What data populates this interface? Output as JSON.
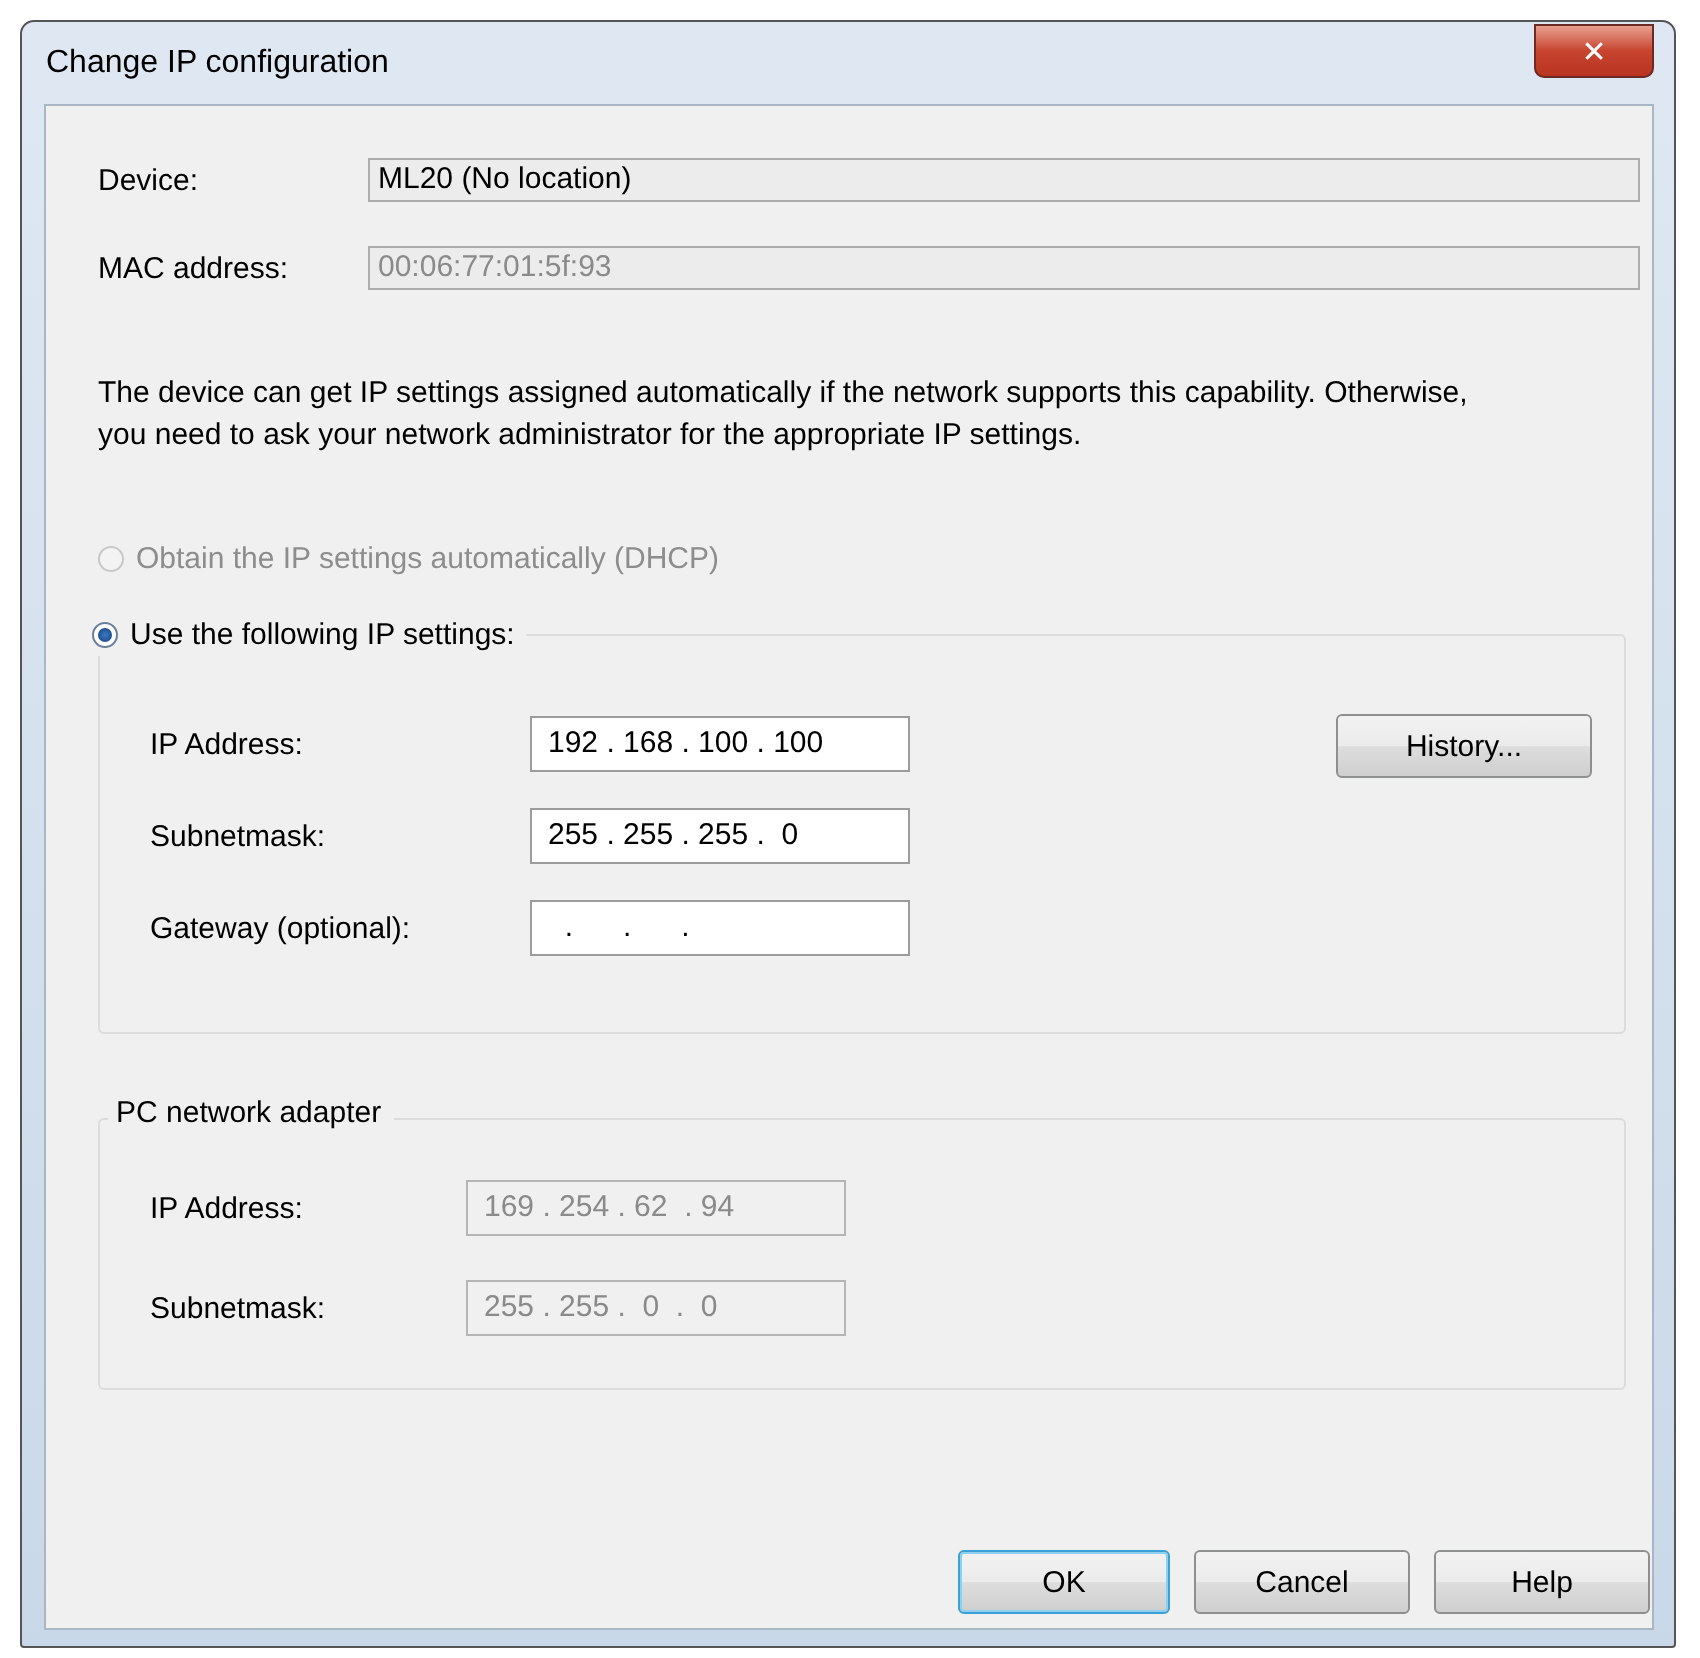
{
  "window": {
    "title": "Change IP configuration",
    "close": "✕"
  },
  "device_info": [
    {
      "label": "Device:",
      "value": "ML20 (No location)",
      "disabled": false
    },
    {
      "label": "MAC address:",
      "value": "00:06:77:01:5f:93",
      "disabled": true
    }
  ],
  "description": "The device can get IP settings assigned automatically if the network supports this capability. Otherwise, you need to ask your network administrator for the appropriate IP settings.",
  "mode_options": [
    {
      "label": "Obtain the IP settings automatically (DHCP)",
      "selected": false,
      "disabled": true
    },
    {
      "label": "Use the following IP settings:",
      "selected": true,
      "disabled": false
    }
  ],
  "ip_settings": {
    "fields": [
      {
        "label": "IP Address:",
        "value": "192 . 168 . 100 . 100"
      },
      {
        "label": "Subnetmask:",
        "value": "255 . 255 . 255 .  0"
      },
      {
        "label": "Gateway (optional):",
        "value": "  .      .      ."
      }
    ],
    "history_button": "History..."
  },
  "pc_adapter": {
    "title": "PC network adapter",
    "fields": [
      {
        "label": "IP Address:",
        "value": "169 . 254 . 62  . 94"
      },
      {
        "label": "Subnetmask:",
        "value": "255 . 255 .  0  .  0"
      }
    ]
  },
  "buttons": [
    {
      "label": "OK",
      "default": true
    },
    {
      "label": "Cancel",
      "default": false
    },
    {
      "label": "Help",
      "default": false
    }
  ]
}
